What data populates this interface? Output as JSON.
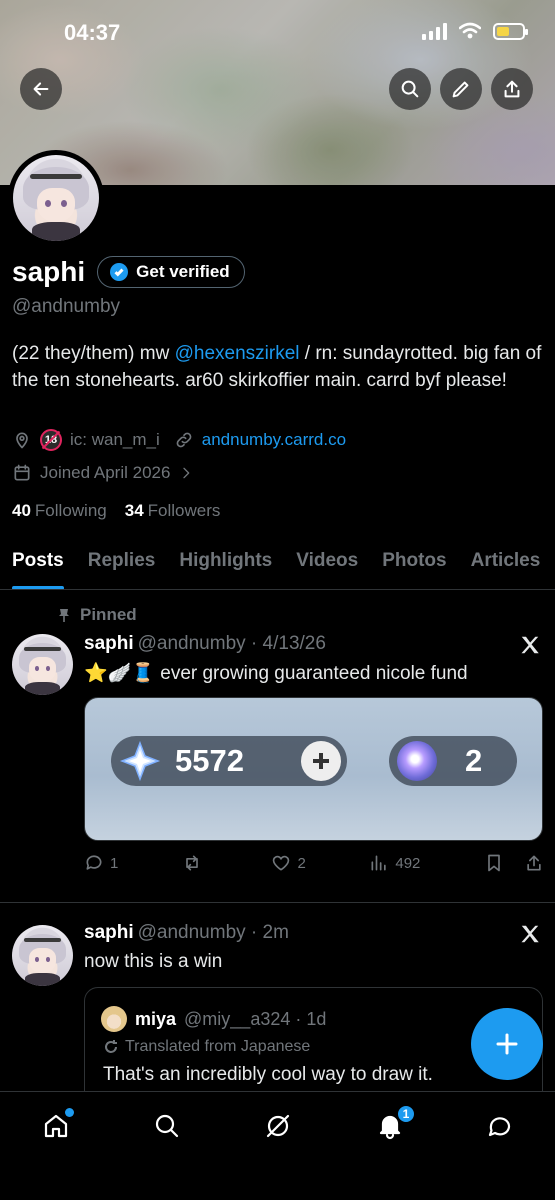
{
  "status_bar": {
    "time": "04:37"
  },
  "profile": {
    "display_name": "saphi",
    "get_verified": "Get verified",
    "handle": "@andnumby",
    "bio_prefix": "(22 they/them) mw ",
    "bio_mention": "@hexenszirkel",
    "bio_suffix": " / rn: sundayrotted. big fan of the ten stonehearts. ar60 skirkoffier main. carrd byf please!",
    "location": "ic: wan_m_i",
    "age_badge": "18",
    "link": "andnumby.carrd.co",
    "joined": "Joined April 2026",
    "following_count": "40",
    "following_label": "Following",
    "followers_count": "34",
    "followers_label": "Followers"
  },
  "tabs": [
    "Posts",
    "Replies",
    "Highlights",
    "Videos",
    "Photos",
    "Articles"
  ],
  "pinned_post": {
    "pinned_label": "Pinned",
    "name": "saphi",
    "handle_time": "@andnumby · 4/13/26",
    "text": "⭐🪽🧵 ever growing guaranteed nicole fund",
    "media": {
      "primogems": "5572",
      "fates": "2"
    },
    "replies": "1",
    "reposts": "",
    "likes": "2",
    "views": "492"
  },
  "second_post": {
    "name": "saphi",
    "handle_time": "@andnumby · 2m",
    "text": "now this is a win",
    "quote": {
      "name": "miya",
      "handle_time": "@miy__a324 · 1d",
      "translated": "Translated from Japanese",
      "text": "That's an incredibly cool way to draw it."
    }
  },
  "bottom_nav": {
    "notifications_count": "1"
  },
  "colors": {
    "accent": "#1d9bf0",
    "background": "#000000",
    "muted": "#71767b"
  }
}
